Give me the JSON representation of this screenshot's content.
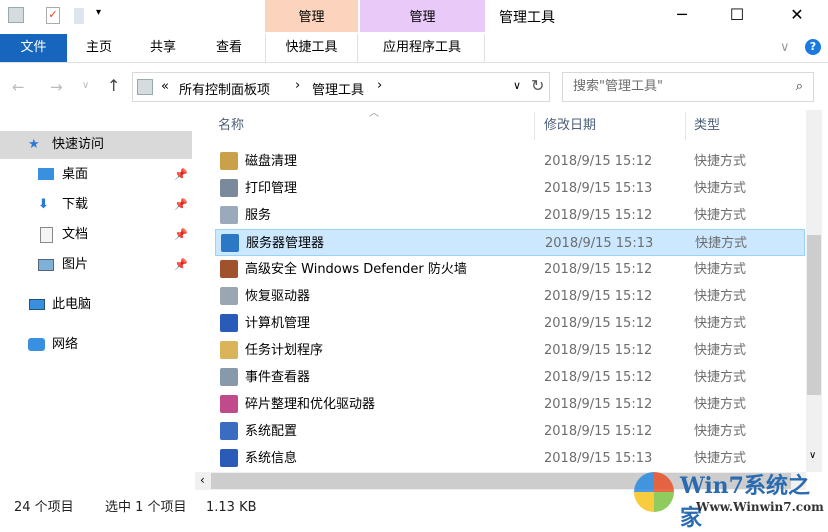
{
  "window": {
    "title": "管理工具",
    "minimize_icon": "minimize-icon",
    "maximize_icon": "maximize-icon",
    "close_icon": "close-icon"
  },
  "context_tabs": [
    {
      "label": "管理",
      "color": "#fcd3bd"
    },
    {
      "label": "管理",
      "color": "#e9c9f7"
    }
  ],
  "ribbon": {
    "file": "文件",
    "tabs": [
      "主页",
      "共享",
      "查看",
      "快捷工具",
      "应用程序工具"
    ],
    "expand_icon": "chevron-down-icon",
    "help_icon": "help-icon"
  },
  "address": {
    "prefix": "«",
    "crumbs": [
      "所有控制面板项",
      "管理工具"
    ],
    "separator": "›"
  },
  "search": {
    "placeholder": "搜索\"管理工具\""
  },
  "nav": {
    "items": [
      {
        "label": "快速访问",
        "icon": "star-icon"
      },
      {
        "label": "桌面",
        "icon": "desktop-icon"
      },
      {
        "label": "下载",
        "icon": "download-icon"
      },
      {
        "label": "文档",
        "icon": "document-icon"
      },
      {
        "label": "图片",
        "icon": "pictures-icon"
      },
      {
        "label": "此电脑",
        "icon": "computer-icon"
      },
      {
        "label": "网络",
        "icon": "network-icon"
      }
    ]
  },
  "columns": {
    "name": "名称",
    "date": "修改日期",
    "type": "类型"
  },
  "files": [
    {
      "name": "磁盘清理",
      "date": "2018/9/15 15:12",
      "type": "快捷方式",
      "color": "#c9a14a"
    },
    {
      "name": "打印管理",
      "date": "2018/9/15 15:13",
      "type": "快捷方式",
      "color": "#7a8a9a"
    },
    {
      "name": "服务",
      "date": "2018/9/15 15:12",
      "type": "快捷方式",
      "color": "#9aaabb"
    },
    {
      "name": "服务器管理器",
      "date": "2018/9/15 15:13",
      "type": "快捷方式",
      "color": "#2b78c5",
      "selected": true
    },
    {
      "name": "高级安全 Windows Defender 防火墙",
      "date": "2018/9/15 15:12",
      "type": "快捷方式",
      "color": "#a0522d"
    },
    {
      "name": "恢复驱动器",
      "date": "2018/9/15 15:12",
      "type": "快捷方式",
      "color": "#9aa6b2"
    },
    {
      "name": "计算机管理",
      "date": "2018/9/15 15:12",
      "type": "快捷方式",
      "color": "#2a5bb8"
    },
    {
      "name": "任务计划程序",
      "date": "2018/9/15 15:12",
      "type": "快捷方式",
      "color": "#d9b45a"
    },
    {
      "name": "事件查看器",
      "date": "2018/9/15 15:12",
      "type": "快捷方式",
      "color": "#8899aa"
    },
    {
      "name": "碎片整理和优化驱动器",
      "date": "2018/9/15 15:12",
      "type": "快捷方式",
      "color": "#c04a8a"
    },
    {
      "name": "系统配置",
      "date": "2018/9/15 15:12",
      "type": "快捷方式",
      "color": "#3a6cc0"
    },
    {
      "name": "系统信息",
      "date": "2018/9/15 15:13",
      "type": "快捷方式",
      "color": "#2a5bb8"
    }
  ],
  "status": {
    "count": "24 个项目",
    "selection": "选中 1 个项目",
    "size": "1.13 KB"
  },
  "watermark": {
    "brand": "Win7系统之家",
    "url": "Www.Winwin7.com"
  }
}
